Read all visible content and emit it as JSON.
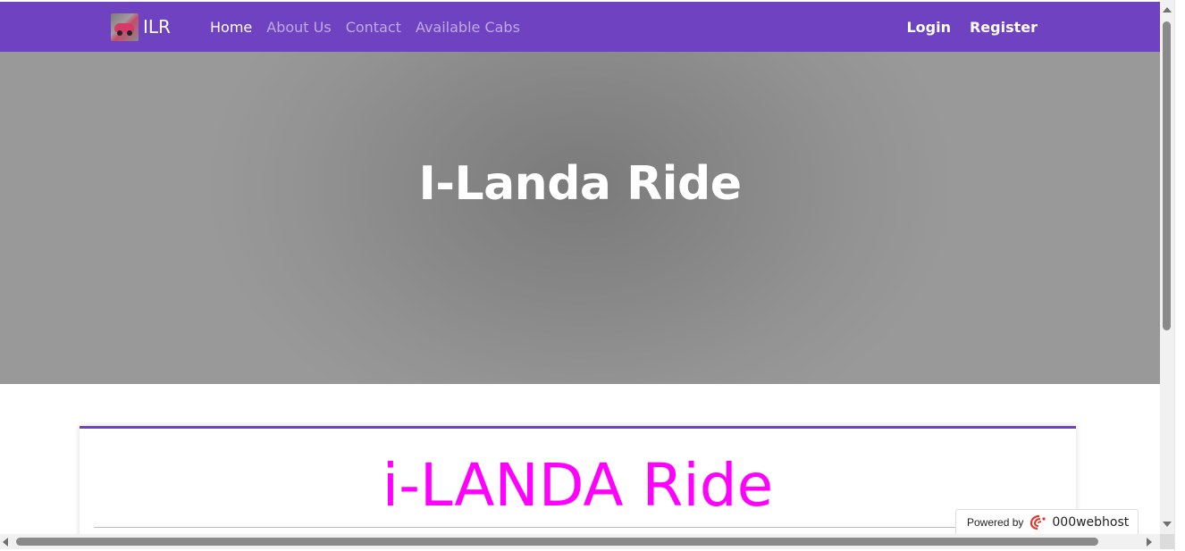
{
  "navbar": {
    "brand_text": "ILR",
    "links": [
      {
        "label": "Home"
      },
      {
        "label": "About Us"
      },
      {
        "label": "Contact"
      },
      {
        "label": "Available Cabs"
      }
    ],
    "login_label": "Login",
    "register_label": "Register",
    "color": "#6f42c1"
  },
  "hero": {
    "title": "I-Landa Ride"
  },
  "card": {
    "title": "i-LANDA Ride",
    "title_color": "#ff00ff"
  },
  "badge": {
    "label": "Powered by",
    "brand": "000webhost"
  }
}
